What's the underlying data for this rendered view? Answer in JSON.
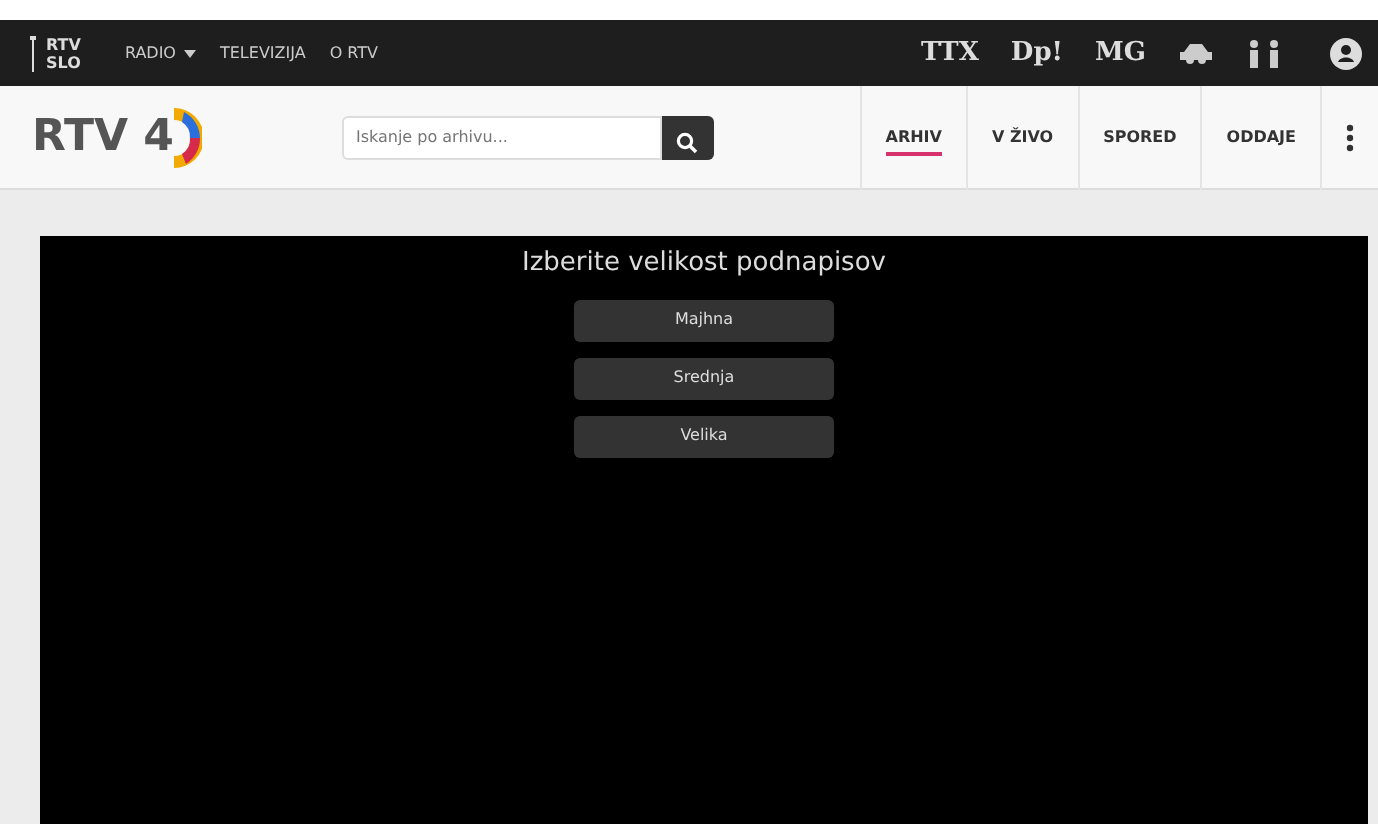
{
  "topbar": {
    "logo_lines": [
      "RTV",
      "SLO"
    ],
    "links": [
      {
        "label": "RADIO",
        "dropdown": true
      },
      {
        "label": "TELEVIZIJA",
        "dropdown": false
      },
      {
        "label": "O RTV",
        "dropdown": false
      }
    ],
    "text_logos": [
      "TTX",
      "Dp!",
      "MG"
    ]
  },
  "navbar": {
    "logo": "RTV 4",
    "search": {
      "placeholder": "Iskanje po arhivu..."
    },
    "tabs": [
      {
        "label": "ARHIV",
        "selected": true
      },
      {
        "label": "V ŽIVO",
        "selected": false
      },
      {
        "label": "SPORED",
        "selected": false
      },
      {
        "label": "ODDAJE",
        "selected": false
      }
    ]
  },
  "player": {
    "title": "Izberite velikost podnapisov",
    "options": [
      "Majhna",
      "Srednja",
      "Velika"
    ]
  }
}
